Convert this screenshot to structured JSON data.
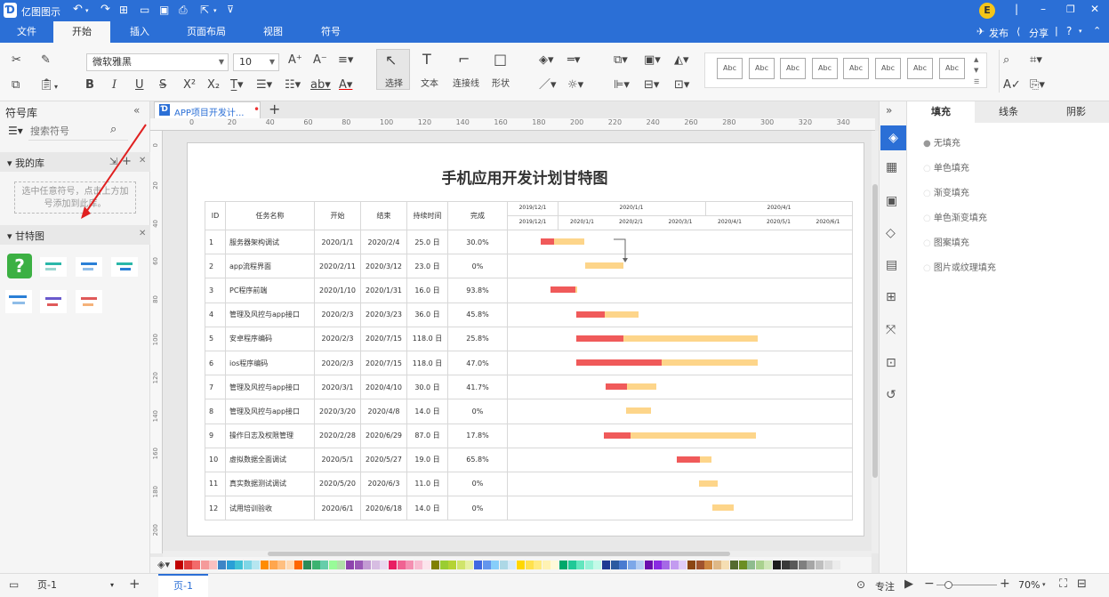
{
  "app": {
    "title": "亿图图示",
    "publish": "发布",
    "share": "分享",
    "user_initial": "E"
  },
  "menu_tabs": [
    {
      "label": "文件"
    },
    {
      "label": "开始"
    },
    {
      "label": "插入"
    },
    {
      "label": "页面布局"
    },
    {
      "label": "视图"
    },
    {
      "label": "符号"
    }
  ],
  "ribbon": {
    "font_name": "微软雅黑",
    "font_size": "10",
    "select": "选择",
    "text": "文本",
    "connector": "连接线",
    "shape": "形状",
    "style_sample": "Abc"
  },
  "left_panel": {
    "title": "符号库",
    "search_placeholder": "搜索符号",
    "my_library": "我的库",
    "my_library_hint": "选中任意符号，点击上方加号添加到此库。",
    "gantt_section": "甘特图"
  },
  "doc_tab": {
    "name": "APP项目开发计..."
  },
  "ruler_top": [
    "0",
    "20",
    "40",
    "60",
    "80",
    "100",
    "120",
    "140",
    "160",
    "180",
    "200",
    "220",
    "240",
    "260",
    "280",
    "300",
    "320",
    "340"
  ],
  "ruler_left": [
    "0",
    "20",
    "40",
    "60",
    "80",
    "100",
    "120",
    "140",
    "160",
    "180",
    "200"
  ],
  "gantt": {
    "title": "手机应用开发计划甘特图",
    "headers": {
      "id": "ID",
      "name": "任务名称",
      "start": "开始",
      "end": "结束",
      "duration": "持续时间",
      "complete": "完成"
    },
    "timeline_top": [
      "2019/12/1",
      "2020/1/1",
      "2020/4/1"
    ],
    "timeline_bottom": [
      "2019/12/1",
      "2020/1/1",
      "2020/2/1",
      "2020/3/1",
      "2020/4/1",
      "2020/5/1",
      "2020/6/1"
    ],
    "rows": [
      {
        "id": "1",
        "name": "服务器架构调试",
        "start": "2020/1/1",
        "end": "2020/2/4",
        "duration": "25.0 日",
        "complete": "30.0%",
        "bar_start": 18.8,
        "bar_len": 24.6,
        "pct": 0.3
      },
      {
        "id": "2",
        "name": "app流程界面",
        "start": "2020/2/11",
        "end": "2020/3/12",
        "duration": "23.0 日",
        "complete": "0%",
        "bar_start": 43.8,
        "bar_len": 21.6,
        "pct": 0
      },
      {
        "id": "3",
        "name": "PC程序前端",
        "start": "2020/1/10",
        "end": "2020/1/31",
        "duration": "16.0 日",
        "complete": "93.8%",
        "bar_start": 24.2,
        "bar_len": 15.2,
        "pct": 0.938
      },
      {
        "id": "4",
        "name": "管理及风控与app接口",
        "start": "2020/2/3",
        "end": "2020/3/23",
        "duration": "36.0 日",
        "complete": "45.8%",
        "bar_start": 38.8,
        "bar_len": 35.4,
        "pct": 0.458
      },
      {
        "id": "5",
        "name": "安卓程序编码",
        "start": "2020/2/3",
        "end": "2020/7/15",
        "duration": "118.0 日",
        "complete": "25.8%",
        "bar_start": 38.8,
        "bar_len": 103,
        "pct": 0.258
      },
      {
        "id": "6",
        "name": "ios程序编码",
        "start": "2020/2/3",
        "end": "2020/7/15",
        "duration": "118.0 日",
        "complete": "47.0%",
        "bar_start": 38.8,
        "bar_len": 103,
        "pct": 0.47
      },
      {
        "id": "7",
        "name": "管理及风控与app接口",
        "start": "2020/3/1",
        "end": "2020/4/10",
        "duration": "30.0 日",
        "complete": "41.7%",
        "bar_start": 55.5,
        "bar_len": 28.5,
        "pct": 0.417
      },
      {
        "id": "8",
        "name": "管理及风控与app接口",
        "start": "2020/3/20",
        "end": "2020/4/8",
        "duration": "14.0 日",
        "complete": "0%",
        "bar_start": 67,
        "bar_len": 14,
        "pct": 0
      },
      {
        "id": "9",
        "name": "操作日志及权限管理",
        "start": "2020/2/28",
        "end": "2020/6/29",
        "duration": "87.0 日",
        "complete": "17.8%",
        "bar_start": 54.5,
        "bar_len": 86,
        "pct": 0.178
      },
      {
        "id": "10",
        "name": "虚拟数据全面调试",
        "start": "2020/5/1",
        "end": "2020/5/27",
        "duration": "19.0 日",
        "complete": "65.8%",
        "bar_start": 96,
        "bar_len": 19.5,
        "pct": 0.658
      },
      {
        "id": "11",
        "name": "真实数据测试调试",
        "start": "2020/5/20",
        "end": "2020/6/3",
        "duration": "11.0 日",
        "complete": "0%",
        "bar_start": 108.5,
        "bar_len": 10.5,
        "pct": 0
      },
      {
        "id": "12",
        "name": "试用培训验收",
        "start": "2020/6/1",
        "end": "2020/6/18",
        "duration": "14.0 日",
        "complete": "0%",
        "bar_start": 116,
        "bar_len": 12,
        "pct": 0
      }
    ]
  },
  "right_panel": {
    "tabs": [
      "填充",
      "线条",
      "阴影"
    ],
    "options": [
      "无填充",
      "单色填充",
      "渐变填充",
      "单色渐变填充",
      "图案填充",
      "图片或纹理填充"
    ]
  },
  "status": {
    "page_select": "页-1",
    "page_tab": "页-1",
    "focus": "专注",
    "zoom": "70%"
  },
  "colors": {
    "accent": "#2b6fd6",
    "done": "#f05a5a",
    "remaining": "#fdd58a"
  },
  "palette": [
    "#c00000",
    "#e03c3c",
    "#f26b6b",
    "#f59a9a",
    "#fac0c0",
    "#3d85c6",
    "#2a9fd6",
    "#41c1d6",
    "#7fd6e6",
    "#b6e6f0",
    "#ff8c00",
    "#ffa64d",
    "#ffbf80",
    "#ffd9b3",
    "#ff6600",
    "#2e8b57",
    "#3cb371",
    "#66cdaa",
    "#98fb98",
    "#b0e0a8",
    "#8e44ad",
    "#9b59b6",
    "#c39bd3",
    "#d7bde2",
    "#e8daef",
    "#e91e63",
    "#f06292",
    "#f48fb1",
    "#f8bbd0",
    "#fce4ec",
    "#808000",
    "#9acd32",
    "#b5d334",
    "#d0e46b",
    "#e6f0a3",
    "#4169e1",
    "#6495ed",
    "#87cefa",
    "#add8e6",
    "#d6eaf8",
    "#ffd700",
    "#ffe14d",
    "#ffeb80",
    "#fff2b3",
    "#fff9d9",
    "#00a86b",
    "#20c997",
    "#63e6be",
    "#96f2d7",
    "#c3fae8",
    "#1f3a93",
    "#2c5aa0",
    "#4a7bd0",
    "#7da7e8",
    "#b3ccf2",
    "#6a0dad",
    "#8a2be2",
    "#a569e6",
    "#c39bf0",
    "#e0ccf7",
    "#8b4513",
    "#a0522d",
    "#cd853f",
    "#deb887",
    "#f5deb3",
    "#556b2f",
    "#6b8e23",
    "#8fbc8f",
    "#a9d18e",
    "#cfe6b8",
    "#1c1c1c",
    "#3a3a3a",
    "#595959",
    "#7f7f7f",
    "#a6a6a6",
    "#bfbfbf",
    "#d9d9d9",
    "#ececec"
  ]
}
